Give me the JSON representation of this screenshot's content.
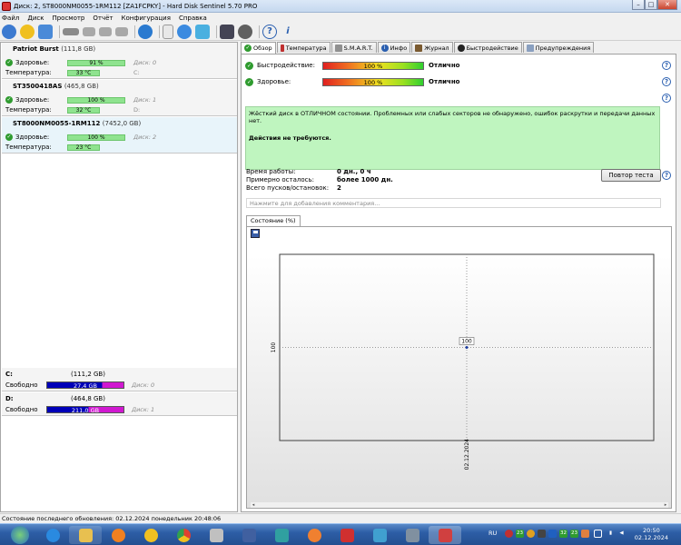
{
  "window": {
    "title": "Диск: 2, ST8000NM0055-1RM112 [ZA1FCPKY] - Hard Disk Sentinel 5.70 PRO",
    "min_label": "–",
    "max_label": "□",
    "close_label": "✕"
  },
  "menu": [
    "Файл",
    "Диск",
    "Просмотр",
    "Отчёт",
    "Конфигурация",
    "Справка"
  ],
  "disks": [
    {
      "name": "Patriot Burst",
      "size": "(111,8 GB)",
      "health_label": "Здоровье:",
      "health": "91 %",
      "disk_no": "Диск: 0",
      "temp_label": "Температура:",
      "temp": "33 °C",
      "drive": "C:"
    },
    {
      "name": "ST3500418AS",
      "size": "(465,8 GB)",
      "health_label": "Здоровье:",
      "health": "100 %",
      "disk_no": "Диск: 1",
      "temp_label": "Температура:",
      "temp": "32 °C",
      "drive": "D:"
    },
    {
      "name": "ST8000NM0055-1RM112",
      "size": "(7452,0 GB)",
      "health_label": "Здоровье:",
      "health": "100 %",
      "disk_no": "Диск: 2",
      "temp_label": "Температура:",
      "temp": "23 °C",
      "drive": ""
    }
  ],
  "volumes": [
    {
      "label": "C:",
      "size": "(111,2 GB)",
      "free_label": "Свободно",
      "free": "27,4 GB",
      "disk_no": "Диск: 0"
    },
    {
      "label": "D:",
      "size": "(464,8 GB)",
      "free_label": "Свободно",
      "free": "211,0 GB",
      "disk_no": "Диск: 1"
    }
  ],
  "tabs": [
    {
      "label": "Обзор",
      "icon": "check-icon",
      "color": "#2f9b2f"
    },
    {
      "label": "Температура",
      "icon": "thermometer-icon",
      "color": "#c03030"
    },
    {
      "label": "S.M.A.R.T.",
      "icon": "smart-icon",
      "color": "#909090"
    },
    {
      "label": "Инфо",
      "icon": "info-icon",
      "color": "#2a5fb0"
    },
    {
      "label": "Журнал",
      "icon": "journal-icon",
      "color": "#7a5a30"
    },
    {
      "label": "Быстродействие",
      "icon": "performance-icon",
      "color": "#222222"
    },
    {
      "label": "Предупреждения",
      "icon": "warning-icon",
      "color": "#8aa0c0"
    }
  ],
  "overview": {
    "performance_label": "Быстродействие:",
    "performance_value": "100 %",
    "performance_text": "Отлично",
    "health_label": "Здоровье:",
    "health_value": "100 %",
    "health_text": "Отлично",
    "status_text": "Жёсткий диск в ОТЛИЧНОМ состоянии. Проблемных или слабых секторов не обнаружено, ошибок раскрутки и передачи данных нет.",
    "action_text": "Действия не требуются.",
    "uptime_label": "Время работы:",
    "uptime_value": "0 дн., 0 ч",
    "remaining_label": "Примерно осталось:",
    "remaining_value": "более 1000 дн.",
    "startstop_label": "Всего пусков/остановок:",
    "startstop_value": "2",
    "retest_label": "Повтор теста",
    "comment_placeholder": "Нажмите для добавления комментария..."
  },
  "chart_data": {
    "type": "line",
    "tab_label": "Состояние (%)",
    "x": [
      "02.12.2024"
    ],
    "series": [
      {
        "values": [
          100
        ]
      }
    ],
    "yticks": [
      "100"
    ],
    "point_label": "100",
    "grid": true
  },
  "statusbar": {
    "text": "Состояние последнего обновления: 02.12.2024 понедельник 20:48:06"
  },
  "taskbar": {
    "lang": "RU",
    "tray1": "23",
    "tray2": "32",
    "tray3": "23",
    "time": "20:50",
    "date": "02.12.2024"
  },
  "colors": {
    "ok_green": "#2f9b2f",
    "status_bg": "#bff5bf",
    "volume_used": "#0000b8",
    "volume_free": "#d018d0"
  }
}
